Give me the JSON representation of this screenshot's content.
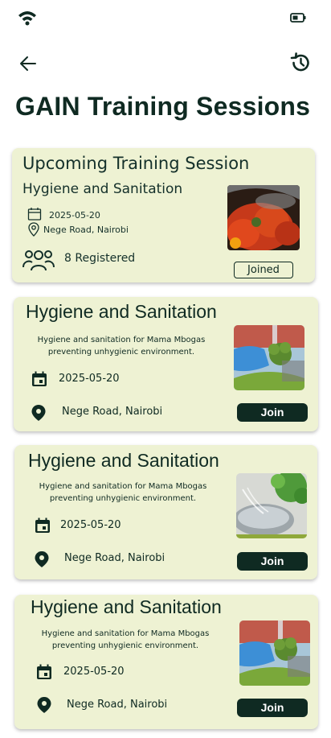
{
  "status_bar": {
    "wifi_icon": "wifi-icon",
    "battery_icon": "battery-icon"
  },
  "header": {
    "back_icon": "arrow-left-icon",
    "history_icon": "history-icon",
    "title": "GAIN Training Sessions"
  },
  "upcoming": {
    "heading": "Upcoming Training Session",
    "title": "Hygiene and Sanitation",
    "date": "2025-05-20",
    "location": "Nege Road, Nairobi",
    "registered": "8 Registered",
    "button_label": "Joined"
  },
  "sessions": [
    {
      "title": "Hygiene and Sanitation",
      "description": "Hygiene and sanitation for Mama Mbogas preventing  unhygienic environment.",
      "date": "2025-05-20",
      "location": "Nege Road, Nairobi",
      "button_label": "Join"
    },
    {
      "title": "Hygiene and Sanitation",
      "description": "Hygiene and sanitation for Mama Mbogas preventing  unhygienic environment.",
      "date": "2025-05-20",
      "location": "Nege Road, Nairobi",
      "button_label": "Join"
    },
    {
      "title": "Hygiene and Sanitation",
      "description": "Hygiene and sanitation for Mama Mbogas preventing  unhygienic environment.",
      "date": "2025-05-20",
      "location": "Nege Road, Nairobi",
      "button_label": "Join"
    }
  ],
  "colors": {
    "card_bg": "#eef2d3",
    "primary": "#0f2a22",
    "text": "#14302a"
  }
}
